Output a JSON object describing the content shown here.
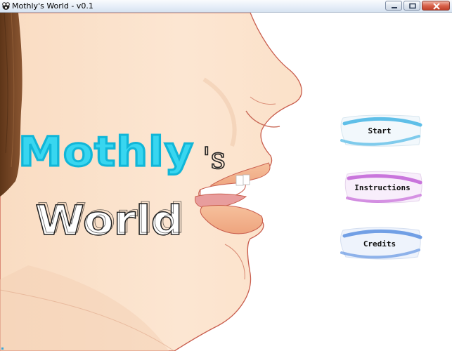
{
  "window": {
    "title": "Mothly's World - v0.1"
  },
  "game": {
    "logo": {
      "line1": "Mothly",
      "apostrophe_s": "'s",
      "line2": "World"
    },
    "menu": [
      {
        "id": "start",
        "label": "Start",
        "color": "#4fb8e6"
      },
      {
        "id": "instructions",
        "label": "Instructions",
        "color": "#c15fd6"
      },
      {
        "id": "credits",
        "label": "Credits",
        "color": "#5b8fe0"
      }
    ]
  },
  "colors": {
    "skin": "#fbe3cd",
    "skin_shade": "#f2c6aa",
    "hair": "#7a4a2a",
    "lips": "#f4b48e",
    "logo_cyan": "#38d6f0"
  }
}
